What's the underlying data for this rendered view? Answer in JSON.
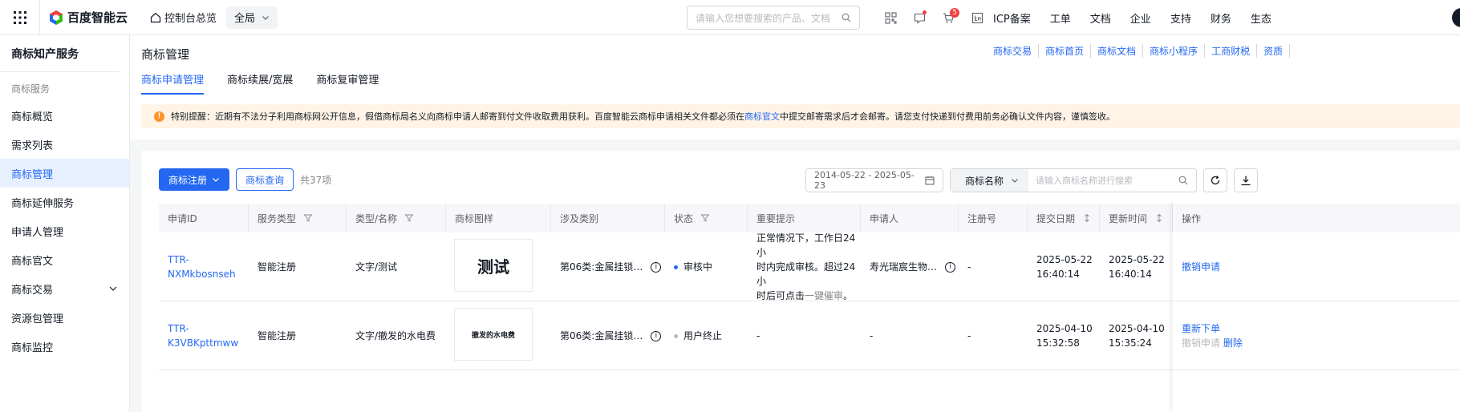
{
  "topbar": {
    "logo_text": "百度智能云",
    "console_home": "控制台总览",
    "region": "全局",
    "search_placeholder": "请输入您想要搜索的产品、文档",
    "cart_badge": "5",
    "links": [
      "ICP备案",
      "工单",
      "文档",
      "企业",
      "支持",
      "财务",
      "生态"
    ]
  },
  "sidebar": {
    "title": "商标知产服务",
    "group": "商标服务",
    "items": [
      "商标概览",
      "需求列表",
      "商标管理",
      "商标延伸服务",
      "申请人管理",
      "商标官文",
      "商标交易",
      "资源包管理",
      "商标监控"
    ]
  },
  "header": {
    "title": "商标管理",
    "quick_links": [
      "商标交易",
      "商标首页",
      "商标文档",
      "商标小程序",
      "工商财税",
      "资质"
    ],
    "tabs": [
      "商标申请管理",
      "商标续展/宽展",
      "商标复审管理"
    ]
  },
  "notice": {
    "before": "特别提醒：近期有不法分子利用商标网公开信息，假借商标局名义向商标申请人邮寄到付文件收取费用获利。百度智能云商标申请相关文件都必须在",
    "link": "商标官文",
    "after": "中提交邮寄需求后才会邮寄。请您支付快递到付费用前务必确认文件内容，谨慎签收。"
  },
  "toolbar": {
    "register_label": "商标注册",
    "query_label": "商标查询",
    "count": "共37项",
    "date_range": "2014-05-22 - 2025-05-23",
    "filter_select": "商标名称",
    "filter_placeholder": "请输入商标名称进行搜索"
  },
  "table": {
    "headers": [
      "申请ID",
      "服务类型",
      "类型/名称",
      "商标图样",
      "涉及类别",
      "状态",
      "重要提示",
      "申请人",
      "注册号",
      "提交日期",
      "更新时间",
      "操作"
    ],
    "rows": [
      {
        "id_line1": "TTR-",
        "id_line2": "NXMkbosnseh",
        "service": "智能注册",
        "type_name": "文字/测试",
        "image_text": "测试",
        "category": "第06类:金属挂锁…",
        "status": "审核中",
        "status_color": "#2468f2",
        "tip_line1": "正常情况下，工作日24小",
        "tip_line2": "时内完成审核。超过24小",
        "tip_line3_prefix": "时后可点击",
        "tip_link": "一键催审",
        "tip_line3_suffix": "。",
        "applicant": "寿光瑞宸生物…",
        "reg_no": "-",
        "submit_date": "2025-05-22",
        "submit_time": "16:40:14",
        "update_date": "2025-05-22",
        "update_time": "16:40:14",
        "action1": "撤销申请",
        "action2": "",
        "action3": ""
      },
      {
        "id_line1": "TTR-",
        "id_line2": "K3VBKpttmww",
        "service": "智能注册",
        "type_name": "文字/撤发的水电费",
        "image_text": "撤发的水电费",
        "category": "第06类:金属挂锁…",
        "status": "用户终止",
        "status_color": "#b8babf",
        "tip": "-",
        "applicant": "-",
        "reg_no": "-",
        "submit_date": "2025-04-10",
        "submit_time": "15:32:58",
        "update_date": "2025-04-10",
        "update_time": "15:35:24",
        "action1": "重新下单",
        "action2": "撤销申请",
        "action3": "删除"
      }
    ]
  }
}
